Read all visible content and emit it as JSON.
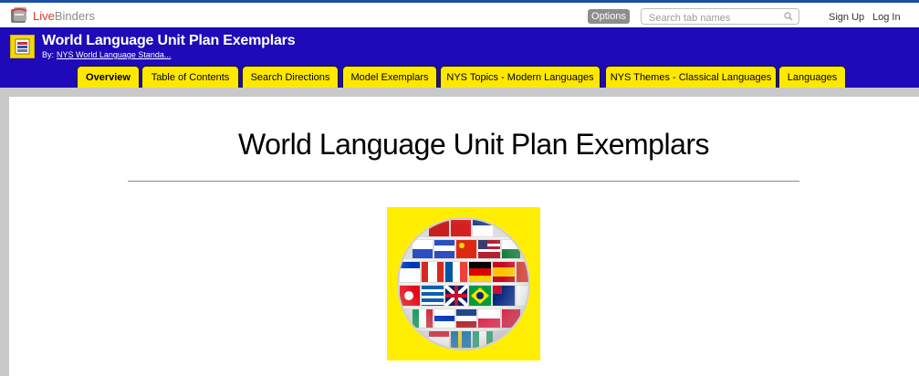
{
  "topbar": {
    "logo_live": "Live",
    "logo_binders": "Binders",
    "options_label": "Options",
    "search_placeholder": "Search tab names",
    "signup_label": "Sign Up",
    "login_label": "Log In"
  },
  "binder": {
    "title": "World Language Unit Plan Exemplars",
    "by_label": "By:",
    "author": "NYS World Language Standa..."
  },
  "tabs": [
    {
      "label": "Overview"
    },
    {
      "label": "Table of Contents"
    },
    {
      "label": "Search Directions"
    },
    {
      "label": "Model Exemplars"
    },
    {
      "label": "NYS Topics - Modern Languages"
    },
    {
      "label": "NYS Themes - Classical Languages"
    },
    {
      "label": "Languages"
    }
  ],
  "content": {
    "heading": "World Language Unit Plan Exemplars"
  },
  "colors": {
    "header_bg": "#1e0ab8",
    "tab_bg": "#ffe800",
    "logo_red": "#d9382a"
  }
}
